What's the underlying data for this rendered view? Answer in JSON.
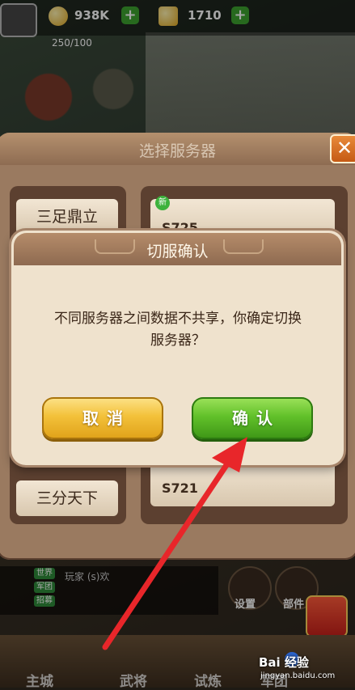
{
  "hud": {
    "silver": "938K",
    "gold": "1710",
    "stamina": "250/100"
  },
  "server_panel": {
    "title": "选择服务器",
    "close_glyph": "✕",
    "zones": [
      "三足鼎立",
      "三分天下"
    ],
    "servers": [
      {
        "name": "S725",
        "badge": "新"
      },
      {
        "name": "S721",
        "badge": ""
      }
    ]
  },
  "dialog": {
    "title": "切服确认",
    "message": "不同服务器之间数据不共享，你确定切换服务器？",
    "cancel_label": "取消",
    "confirm_label": "确认"
  },
  "side_buttons": [
    "设置",
    "部件"
  ],
  "bottom_nav": [
    "主城",
    "武将",
    "试炼",
    "军团"
  ],
  "chat": {
    "tags": [
      "世界",
      "军团",
      "招募"
    ],
    "text": "玩家 (s)欢"
  },
  "watermark": {
    "brand": "Bai 经验",
    "url": "jingyan.baidu.com"
  },
  "colors": {
    "cancel": "#f3c13a",
    "confirm": "#62c12a",
    "arrow": "#e8262a",
    "dialog_bg": "#efe2cd"
  }
}
